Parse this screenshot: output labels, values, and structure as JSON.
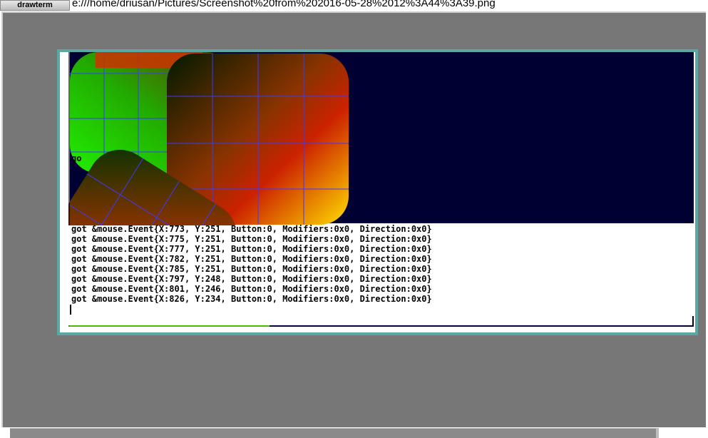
{
  "topbar": {
    "app_label": "drawterm",
    "path": "e:///home/driusan/Pictures/Screenshot%20from%202016-05-28%2012%3A44%3A39.png"
  },
  "window": {
    "partial_text": "go",
    "log_lines": [
      "got &mouse.Event{X:773, Y:251, Button:0, Modifiers:0x0, Direction:0x0}",
      "got &mouse.Event{X:775, Y:251, Button:0, Modifiers:0x0, Direction:0x0}",
      "got &mouse.Event{X:777, Y:251, Button:0, Modifiers:0x0, Direction:0x0}",
      "got &mouse.Event{X:782, Y:251, Button:0, Modifiers:0x0, Direction:0x0}",
      "got &mouse.Event{X:785, Y:251, Button:0, Modifiers:0x0, Direction:0x0}",
      "got &mouse.Event{X:797, Y:248, Button:0, Modifiers:0x0, Direction:0x0}",
      "got &mouse.Event{X:801, Y:246, Button:0, Modifiers:0x0, Direction:0x0}",
      "got &mouse.Event{X:826, Y:234, Button:0, Modifiers:0x0, Direction:0x0}"
    ]
  },
  "colors": {
    "workspace": "#777777",
    "window_border": "#5aa7a4",
    "dark_navy": "#000033",
    "grid_lines": "#3a3aff"
  }
}
